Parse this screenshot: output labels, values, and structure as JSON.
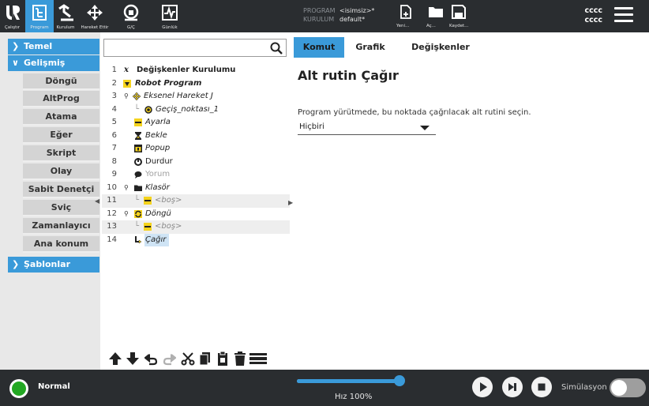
{
  "topbar": {
    "nav": [
      {
        "label": "Çalıştır",
        "icon": "ur-logo-icon"
      },
      {
        "label": "Program",
        "icon": "program-icon",
        "active": true
      },
      {
        "label": "Kurulum",
        "icon": "installation-icon"
      },
      {
        "label": "Hareket Ettir",
        "icon": "move-icon"
      },
      {
        "label": "G/Ç",
        "icon": "io-icon"
      },
      {
        "label": "Günlük",
        "icon": "log-icon"
      }
    ],
    "program_key": "PROGRAM",
    "program_value": "<isimsiz>*",
    "installation_key": "KURULUM",
    "installation_value": "default*",
    "file_new": "Yeni...",
    "file_open": "Aç...",
    "file_save": "Kaydet...",
    "user_line1": "cccc",
    "user_line2": "cccc"
  },
  "leftnav": {
    "temel": "Temel",
    "gelismis": "Gelişmiş",
    "items": [
      "Döngü",
      "AltProg",
      "Atama",
      "Eğer",
      "Skript",
      "Olay",
      "Sabit Denetçi",
      "Sviç",
      "Zamanlayıcı",
      "Ana konum"
    ],
    "sablonlar": "Şablonlar"
  },
  "tree": {
    "search_placeholder": "",
    "rows": [
      {
        "num": "1",
        "text": "Değişkenler Kurulumu"
      },
      {
        "num": "2",
        "text": "Robot Program"
      },
      {
        "num": "3",
        "text": "Eksenel Hareket J"
      },
      {
        "num": "4",
        "text": "Geçiş_noktası_1"
      },
      {
        "num": "5",
        "text": "Ayarla"
      },
      {
        "num": "6",
        "text": "Bekle"
      },
      {
        "num": "7",
        "text": "Popup"
      },
      {
        "num": "8",
        "text": "Durdur"
      },
      {
        "num": "9",
        "text": "Yorum"
      },
      {
        "num": "10",
        "text": "Klasör"
      },
      {
        "num": "11",
        "text": "<boş>"
      },
      {
        "num": "12",
        "text": "Döngü"
      },
      {
        "num": "13",
        "text": "<boş>"
      },
      {
        "num": "14",
        "text": "Çağır"
      }
    ]
  },
  "tabs": [
    "Komut",
    "Grafik",
    "Değişkenler"
  ],
  "panel": {
    "title": "Alt rutin Çağır",
    "description": "Program yürütmede, bu noktada çağrılacak alt rutini seçin.",
    "select_value": "Hiçbiri"
  },
  "bottombar": {
    "status": "Normal",
    "speed_label": "Hız 100%",
    "speed_fraction": 1.0,
    "sim_label": "Simülasyon"
  },
  "colors": {
    "accent": "#3a9ad9",
    "bar": "#2a2d30",
    "node_yellow": "#f5d31c"
  }
}
